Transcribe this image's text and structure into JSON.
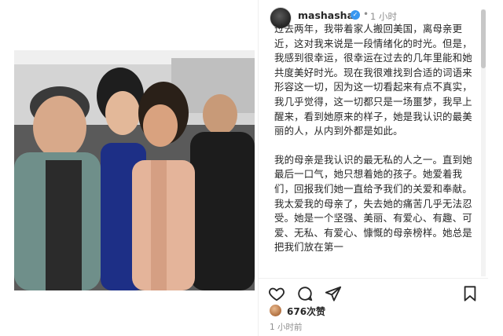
{
  "post": {
    "username": "mashasha",
    "time_ago_header": "1 小时",
    "dot": "•",
    "caption_paragraphs": [
      "过去两年，我带着家人搬回美国，离母亲更近，这对我来说是一段情绪化的时光。但是，我感到很幸运，很幸运在过去的几年里能和她共度美好时光。现在我很难找到合适的词语来形容这一切，因为这一切看起来有点不真实，我几乎觉得，这一切都只是一场噩梦，我早上醒来，看到她原来的样子，她是我认识的最美丽的人，从内到外都是如此。",
      "我的母亲是我认识的最无私的人之一。直到她最后一口气，她只想着她的孩子。她爱着我们，回报我们她一直给予我们的关爱和奉献。我太爱我的母亲了，失去她的痛苦几乎无法忍受。她是一个坚强、美丽、有爱心、有趣、可爱、无私、有爱心、慷慨的母亲榜样。她总是把我们放在第一"
    ],
    "likes_text": "676次赞",
    "time_ago_footer": "1 小时前"
  },
  "icons": {
    "verified": "verified-badge-icon",
    "like": "heart-icon",
    "comment": "comment-icon",
    "share": "send-icon",
    "save": "bookmark-icon"
  },
  "colors": {
    "verified_blue": "#3897f0",
    "text_primary": "#262626",
    "text_secondary": "#8e8e8e"
  }
}
